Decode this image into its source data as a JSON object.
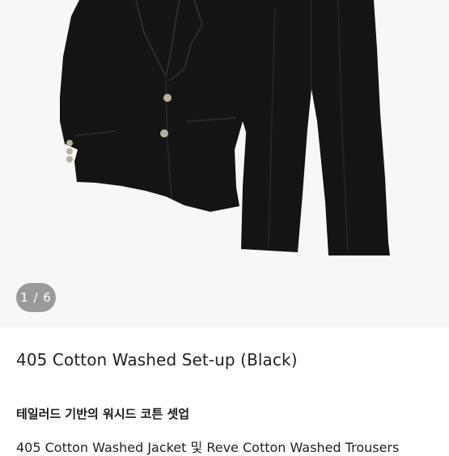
{
  "gallery": {
    "counter": "1 / 6",
    "image_alt": "405 Cotton Washed Set-up (Black) jacket and trousers"
  },
  "product": {
    "title": "405 Cotton Washed Set-up (Black)",
    "subtitle": "테일러드 기반의 워시드 코튼 셋업",
    "description": "405 Cotton Washed Jacket 및 Reve Cotton Washed Trousers"
  },
  "colors": {
    "gallery_bg": "#f7f7f7",
    "garment": "#141414",
    "button": "#b7b09c",
    "counter_bg": "#808080"
  }
}
